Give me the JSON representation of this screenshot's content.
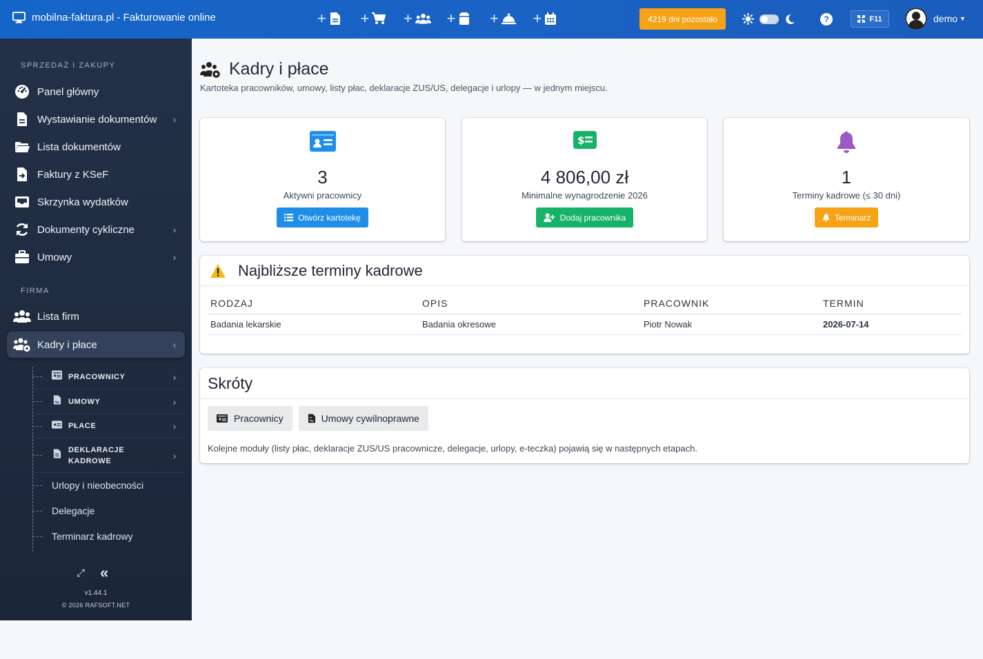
{
  "topbar": {
    "brand": "mobilna-faktura.pl - Fakturowanie online",
    "quick_actions": [
      "add-document-icon",
      "add-purchase-icon",
      "add-users-icon",
      "add-box-icon",
      "add-service-icon",
      "add-calendar-icon"
    ],
    "days_left": "4219 dni pozostało",
    "help": "?",
    "f11": "F11",
    "user": "demo",
    "colors": {
      "bar": "#1a62c4",
      "badge": "#f6a316"
    }
  },
  "sidebar": {
    "section_sales": "SPRZEDAŻ I ZAKUPY",
    "items": [
      {
        "label": "Panel główny",
        "icon": "dashboard-icon"
      },
      {
        "label": "Wystawianie dokumentów",
        "icon": "file-icon"
      },
      {
        "label": "Lista dokumentów",
        "icon": "folder-icon"
      },
      {
        "label": "Faktury z KSeF",
        "icon": "file-import-icon"
      },
      {
        "label": "Skrzynka wydatków",
        "icon": "inbox-icon"
      },
      {
        "label": "Dokumenty cykliczne",
        "icon": "sync-icon"
      },
      {
        "label": "Umowy",
        "icon": "briefcase-icon"
      }
    ],
    "section_company": "FIRMA",
    "company_items": [
      {
        "label": "Lista firm",
        "icon": "users-icon"
      },
      {
        "label": "Kadry i płace",
        "icon": "users-cog-icon"
      }
    ],
    "sub_items": [
      {
        "label": "PRACOWNICY"
      },
      {
        "label": "UMOWY"
      },
      {
        "label": "PŁACE"
      },
      {
        "label_line1": "DEKLARACJE",
        "label_line2": "KADROWE"
      }
    ],
    "sub_plain": [
      "Urlopy i nieobecności",
      "Delegacje",
      "Terminarz kadrowy"
    ],
    "version": "v1.44.1",
    "copyright": "© 2026 RAFSOFT.NET"
  },
  "page": {
    "title": "Kadry i płace",
    "subtitle": "Kartoteka pracowników, umowy, listy płac, deklaracje ZUS/US, delegacje i urlopy — w jednym miejscu."
  },
  "stats": [
    {
      "value": "3",
      "caption": "Aktywni pracownicy",
      "button": "Otwórz kartotekę",
      "color": "#1f8ee8"
    },
    {
      "value": "4 806,00 zł",
      "caption": "Minimalne wynagrodzenie 2026",
      "button": "Dodaj pracownika",
      "color": "#17b26a"
    },
    {
      "value": "1",
      "caption": "Terminy kadrowe (≤ 30 dni)",
      "button": "Terminarz",
      "color": "#f6a316"
    }
  ],
  "terms": {
    "title": "Najbliższe terminy kadrowe",
    "columns": [
      "RODZAJ",
      "OPIS",
      "PRACOWNIK",
      "TERMIN"
    ],
    "rows": [
      [
        "Badania lekarskie",
        "Badania okresowe",
        "Piotr Nowak",
        "2026-07-14"
      ]
    ]
  },
  "shortcuts": {
    "title": "Skróty",
    "buttons": [
      "Pracownicy",
      "Umowy cywilnoprawne"
    ],
    "note": "Kolejne moduły (listy płac, deklaracje ZUS/US pracownicze, delegacje, urlopy, e-teczka) pojawią się w następnych etapach."
  }
}
